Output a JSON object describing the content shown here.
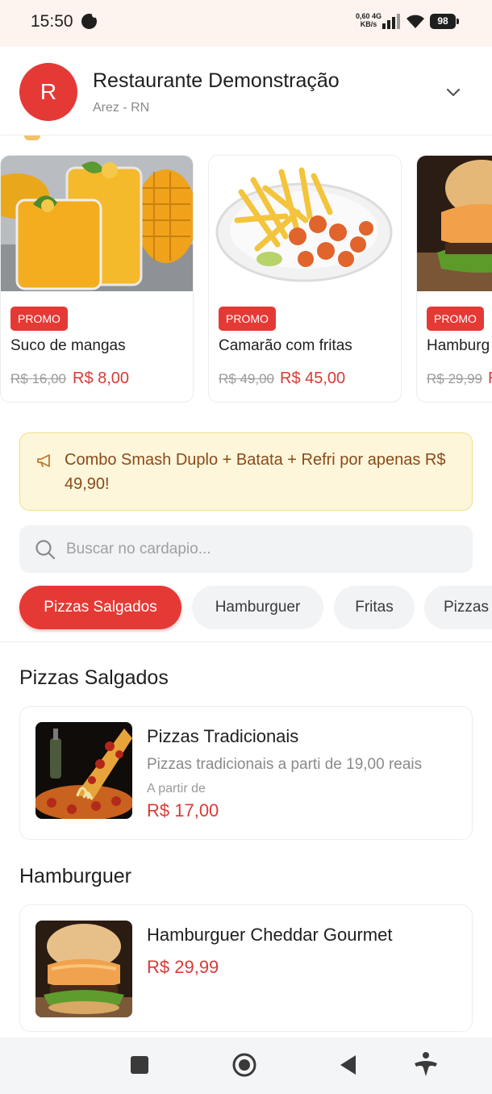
{
  "status_bar": {
    "time": "15:50",
    "speed_value": "0,60 4G",
    "speed_unit": "KB/s",
    "battery": "98"
  },
  "header": {
    "avatar_letter": "R",
    "restaurant_name": "Restaurante Demonstração",
    "city": "Arez - RN",
    "accent_color": "#e53935"
  },
  "promos": [
    {
      "badge": "PROMO",
      "name": "Suco de mangas",
      "old_price": "R$ 16,00",
      "new_price": "R$ 8,00"
    },
    {
      "badge": "PROMO",
      "name": "Camarão com fritas",
      "old_price": "R$ 49,00",
      "new_price": "R$ 45,00"
    },
    {
      "badge": "PROMO",
      "name": "Hamburg",
      "old_price": "R$ 29,99",
      "new_price": "R"
    }
  ],
  "announcement": {
    "icon": "megaphone-icon",
    "text": "Combo Smash Duplo + Batata + Refri por apenas R$ 49,90!"
  },
  "search": {
    "placeholder": "Buscar no cardapio...",
    "value": ""
  },
  "categories": [
    "Pizzas Salgados",
    "Hamburguer",
    "Fritas",
    "Pizzas"
  ],
  "active_category": "Pizzas Salgados",
  "sections": [
    {
      "title": "Pizzas Salgados",
      "items": [
        {
          "name": "Pizzas Tradicionais",
          "description": "Pizzas tradicionais a parti de 19,00 reais",
          "price_prefix": "A partir de",
          "price": "R$ 17,00"
        }
      ]
    },
    {
      "title": "Hamburguer",
      "items": [
        {
          "name": "Hamburguer Cheddar Gourmet",
          "price": "R$ 29,99"
        }
      ]
    }
  ],
  "nav": [
    "square-icon",
    "home-circle-icon",
    "back-triangle-icon",
    "accessibility-icon"
  ]
}
